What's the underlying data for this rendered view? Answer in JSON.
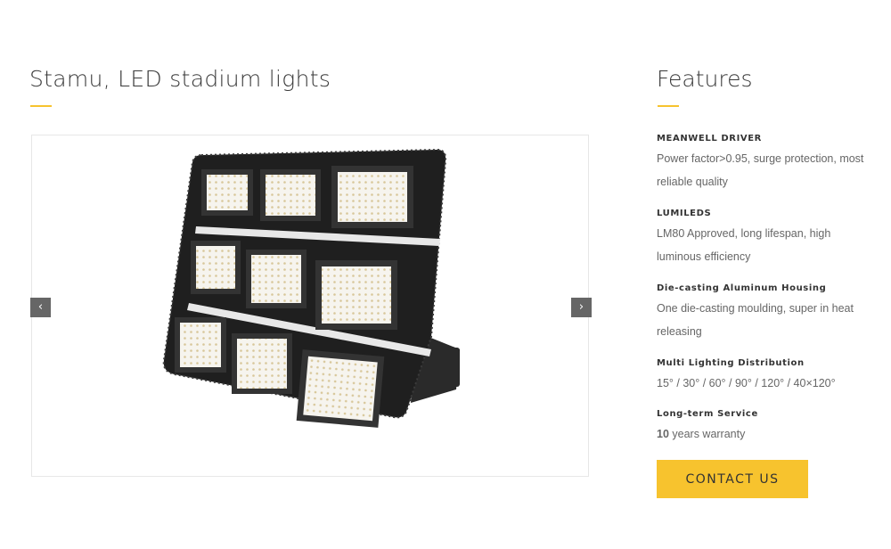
{
  "product": {
    "title": "Stamu, LED stadium lights",
    "image_alt": "LED stadium floodlight with nine LED modules on a mounting bracket"
  },
  "slider": {
    "prev_icon": "‹",
    "next_icon": "›"
  },
  "features": {
    "title": "Features",
    "items": [
      {
        "heading": "MEANWELL DRIVER",
        "description": "Power factor>0.95, surge protection, most reliable quality"
      },
      {
        "heading": "LUMILEDS",
        "description": "LM80 Approved, long lifespan, high luminous efficiency"
      },
      {
        "heading": "Die-casting Aluminum Housing",
        "description": "One die-casting moulding, super in heat releasing"
      },
      {
        "heading": "Multi Lighting Distribution",
        "description": "15° / 30° / 60° / 90° / 120° / 40×120°"
      },
      {
        "heading": "Long-term Service",
        "description_bold": "10",
        "description": " years warranty"
      }
    ]
  },
  "cta": {
    "label": "CONTACT US"
  },
  "colors": {
    "accent": "#f7c32e",
    "arrow_bg": "#666666"
  }
}
